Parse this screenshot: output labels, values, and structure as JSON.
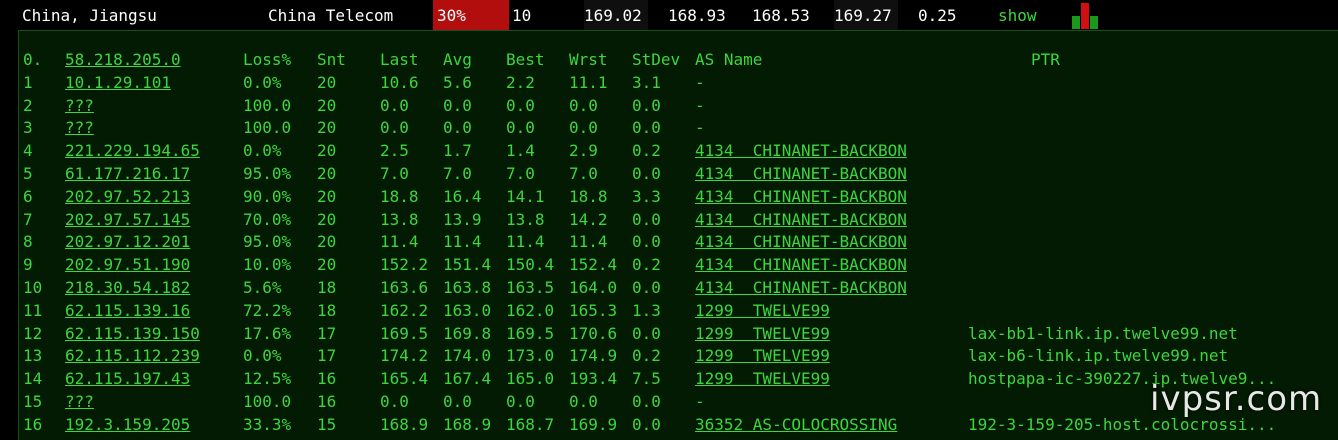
{
  "summary": {
    "location": "China, Jiangsu",
    "isp": "China Telecom",
    "loss": "30%",
    "sent": "10",
    "last": "169.02",
    "avg": "168.93",
    "best": "168.53",
    "worst": "169.27",
    "stdev": "0.25",
    "show_label": "show",
    "loss_color": "#b20e0e",
    "sparkline": [
      {
        "level": 0.5,
        "color": "#1a9a1a"
      },
      {
        "level": 1.0,
        "color": "#d01010"
      },
      {
        "level": 0.5,
        "color": "#1a9a1a"
      }
    ]
  },
  "table": {
    "headers": {
      "idx": "0.",
      "host": "58.218.205.0",
      "loss": "Loss%",
      "snt": "Snt",
      "last": "Last",
      "avg": "Avg",
      "best": "Best",
      "wrst": "Wrst",
      "stdev": "StDev",
      "as": "AS Name",
      "ptr": "PTR"
    },
    "rows": [
      {
        "idx": "1",
        "host": "10.1.29.101",
        "loss": "0.0%",
        "snt": "20",
        "last": "10.6",
        "avg": "5.6",
        "best": "2.2",
        "wrst": "11.1",
        "stdev": "3.1",
        "as": "-",
        "ptr": ""
      },
      {
        "idx": "2",
        "host": "???",
        "loss": "100.0",
        "snt": "20",
        "last": "0.0",
        "avg": "0.0",
        "best": "0.0",
        "wrst": "0.0",
        "stdev": "0.0",
        "as": "-",
        "ptr": ""
      },
      {
        "idx": "3",
        "host": "???",
        "loss": "100.0",
        "snt": "20",
        "last": "0.0",
        "avg": "0.0",
        "best": "0.0",
        "wrst": "0.0",
        "stdev": "0.0",
        "as": "-",
        "ptr": ""
      },
      {
        "idx": "4",
        "host": "221.229.194.65",
        "loss": "0.0%",
        "snt": "20",
        "last": "2.5",
        "avg": "1.7",
        "best": "1.4",
        "wrst": "2.9",
        "stdev": "0.2",
        "as": "4134  CHINANET-BACKBON",
        "ptr": ""
      },
      {
        "idx": "5",
        "host": "61.177.216.17",
        "loss": "95.0%",
        "snt": "20",
        "last": "7.0",
        "avg": "7.0",
        "best": "7.0",
        "wrst": "7.0",
        "stdev": "0.0",
        "as": "4134  CHINANET-BACKBON",
        "ptr": ""
      },
      {
        "idx": "6",
        "host": "202.97.52.213",
        "loss": "90.0%",
        "snt": "20",
        "last": "18.8",
        "avg": "16.4",
        "best": "14.1",
        "wrst": "18.8",
        "stdev": "3.3",
        "as": "4134  CHINANET-BACKBON",
        "ptr": ""
      },
      {
        "idx": "7",
        "host": "202.97.57.145",
        "loss": "70.0%",
        "snt": "20",
        "last": "13.8",
        "avg": "13.9",
        "best": "13.8",
        "wrst": "14.2",
        "stdev": "0.0",
        "as": "4134  CHINANET-BACKBON",
        "ptr": ""
      },
      {
        "idx": "8",
        "host": "202.97.12.201",
        "loss": "95.0%",
        "snt": "20",
        "last": "11.4",
        "avg": "11.4",
        "best": "11.4",
        "wrst": "11.4",
        "stdev": "0.0",
        "as": "4134  CHINANET-BACKBON",
        "ptr": ""
      },
      {
        "idx": "9",
        "host": "202.97.51.190",
        "loss": "10.0%",
        "snt": "20",
        "last": "152.2",
        "avg": "151.4",
        "best": "150.4",
        "wrst": "152.4",
        "stdev": "0.2",
        "as": "4134  CHINANET-BACKBON",
        "ptr": ""
      },
      {
        "idx": "10",
        "host": "218.30.54.182",
        "loss": "5.6%",
        "snt": "18",
        "last": "163.6",
        "avg": "163.8",
        "best": "163.5",
        "wrst": "164.0",
        "stdev": "0.0",
        "as": "4134  CHINANET-BACKBON",
        "ptr": ""
      },
      {
        "idx": "11",
        "host": "62.115.139.16",
        "loss": "72.2%",
        "snt": "18",
        "last": "162.2",
        "avg": "163.0",
        "best": "162.0",
        "wrst": "165.3",
        "stdev": "1.3",
        "as": "1299  TWELVE99",
        "ptr": ""
      },
      {
        "idx": "12",
        "host": "62.115.139.150",
        "loss": "17.6%",
        "snt": "17",
        "last": "169.5",
        "avg": "169.8",
        "best": "169.5",
        "wrst": "170.6",
        "stdev": "0.0",
        "as": "1299  TWELVE99",
        "ptr": "lax-bb1-link.ip.twelve99.net"
      },
      {
        "idx": "13",
        "host": "62.115.112.239",
        "loss": "0.0%",
        "snt": "17",
        "last": "174.2",
        "avg": "174.0",
        "best": "173.0",
        "wrst": "174.9",
        "stdev": "0.2",
        "as": "1299  TWELVE99",
        "ptr": "lax-b6-link.ip.twelve99.net"
      },
      {
        "idx": "14",
        "host": "62.115.197.43",
        "loss": "12.5%",
        "snt": "16",
        "last": "165.4",
        "avg": "167.4",
        "best": "165.0",
        "wrst": "193.4",
        "stdev": "7.5",
        "as": "1299  TWELVE99",
        "ptr": "hostpapa-ic-390227.ip.twelve9..."
      },
      {
        "idx": "15",
        "host": "???",
        "loss": "100.0",
        "snt": "16",
        "last": "0.0",
        "avg": "0.0",
        "best": "0.0",
        "wrst": "0.0",
        "stdev": "0.0",
        "as": "-",
        "ptr": ""
      },
      {
        "idx": "16",
        "host": "192.3.159.205",
        "loss": "33.3%",
        "snt": "15",
        "last": "168.9",
        "avg": "168.9",
        "best": "168.7",
        "wrst": "169.9",
        "stdev": "0.0",
        "as": "36352 AS-COLOCROSSING",
        "ptr": "192-3-159-205-host.colocrossi..."
      }
    ]
  },
  "watermark": "ivpsr.com"
}
